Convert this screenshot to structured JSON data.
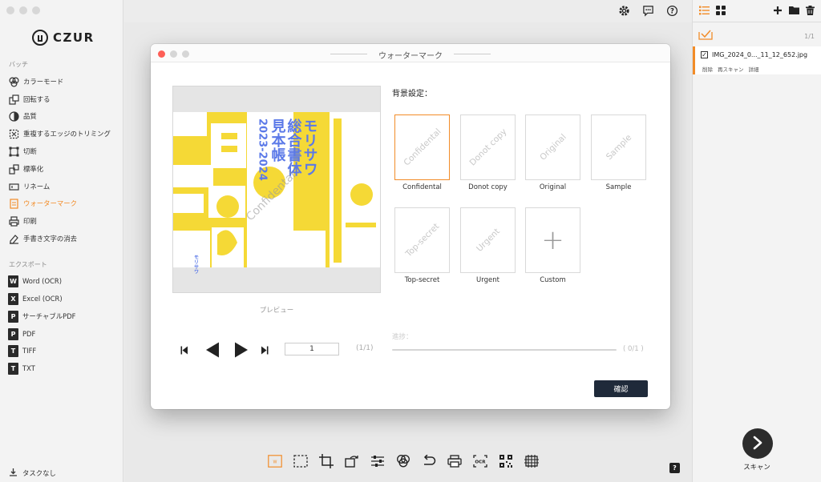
{
  "app": {
    "brand": "CZUR"
  },
  "sidebar": {
    "batch_title": "バッチ",
    "batch_items": [
      {
        "label": "カラーモード",
        "icon": "color-mode-icon"
      },
      {
        "label": "回転する",
        "icon": "rotate-icon"
      },
      {
        "label": "品質",
        "icon": "quality-icon"
      },
      {
        "label": "重複するエッジのトリミング",
        "icon": "edge-trim-icon"
      },
      {
        "label": "切断",
        "icon": "cut-icon"
      },
      {
        "label": "標準化",
        "icon": "standardize-icon"
      },
      {
        "label": "リネーム",
        "icon": "rename-icon"
      },
      {
        "label": "ウォーターマーク",
        "icon": "watermark-icon",
        "active": true
      },
      {
        "label": "印刷",
        "icon": "print-icon"
      },
      {
        "label": "手書き文字の消去",
        "icon": "eraser-icon"
      }
    ],
    "export_title": "エクスポート",
    "export_items": [
      {
        "label": "Word (OCR)",
        "glyph": "W"
      },
      {
        "label": "Excel (OCR)",
        "glyph": "X"
      },
      {
        "label": "サーチャブルPDF",
        "glyph": "P"
      },
      {
        "label": "PDF",
        "glyph": "P"
      },
      {
        "label": "TIFF",
        "glyph": "T"
      },
      {
        "label": "TXT",
        "glyph": "T"
      }
    ],
    "tasks_label": "タスクなし"
  },
  "right_panel": {
    "page_count": "1/1",
    "file": {
      "name": "IMG_2024_0..._11_12_652.jpg",
      "actions": [
        "削除",
        "再スキャン",
        "詳細"
      ]
    },
    "scan_label": "スキャン"
  },
  "dialog": {
    "title": "ウォーターマーク",
    "background_label": "背景設定：",
    "preview_label": "プレビュー",
    "current_page": "1",
    "total_pages": "(1/1)",
    "progress_label": "進捗：",
    "progress_count": "( 0/1 )",
    "progress_fraction": 0,
    "confirm_label": "確認",
    "watermarks": [
      {
        "name": "Confidental",
        "text": "Confidental",
        "selected": true
      },
      {
        "name": "Donot copy",
        "text": "Donot copy",
        "selected": false
      },
      {
        "name": "Original",
        "text": "Original",
        "selected": false
      },
      {
        "name": "Sample",
        "text": "Sample",
        "selected": false
      },
      {
        "name": "Top-secret",
        "text": "Top-secret",
        "selected": false
      },
      {
        "name": "Urgent",
        "text": "Urgent",
        "selected": false
      },
      {
        "name": "Custom",
        "text": "+",
        "selected": false
      }
    ]
  },
  "preview_image": {
    "cover_lines": [
      "モリサワ",
      "総合書体",
      "見本帳",
      "2023-2024"
    ],
    "watermark_overlay": "Confidental",
    "brand_small": "モリサワ"
  },
  "colors": {
    "accent": "#f28c28",
    "confirm": "#1f2a3a",
    "cover_yellow": "#f5d936",
    "cover_blue": "#5b79e8"
  }
}
